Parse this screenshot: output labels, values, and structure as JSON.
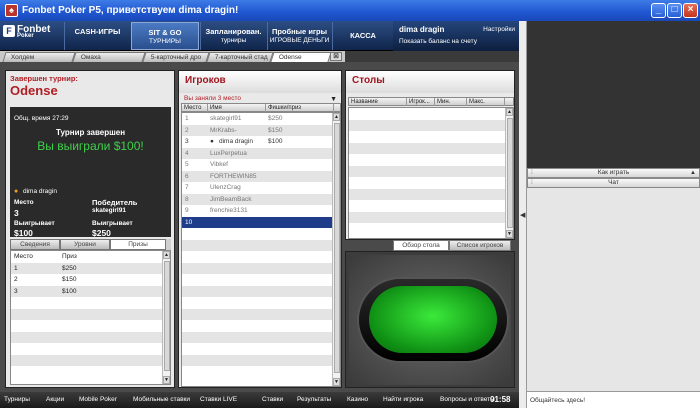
{
  "window": {
    "title": "Fonbet Poker P5, приветствуем dima dragin!",
    "icon": "fonbet-app-icon"
  },
  "logo": {
    "name": "Fonbet",
    "sub": "Poker",
    "mark": "F"
  },
  "nav": [
    {
      "l1": "CASH-ИГРЫ",
      "l2": ""
    },
    {
      "l1": "SIT & GO",
      "l2": "ТУРНИРЫ"
    },
    {
      "l1": "Запланирован.",
      "l2": "турниры"
    },
    {
      "l1": "Пробные игры",
      "l2": "ИГРОВЫЕ ДЕНЬГИ"
    },
    {
      "l1": "КАССА",
      "l2": ""
    }
  ],
  "user": {
    "name": "dima dragin",
    "settings": "Настройки",
    "balance": "Показать баланс на счету"
  },
  "game_tabs": [
    "Холдем",
    "Омаха",
    "5-карточный дро",
    "7-карточный стад",
    "Odense"
  ],
  "tournament": {
    "status": "Завершен турнир:",
    "name": "Odense",
    "time_label": "Общ. время",
    "time": "27:29",
    "done": "Турнир завершен",
    "won": "Вы выиграли $100!",
    "player": "dima dragin",
    "place_label": "Место",
    "place": "3",
    "wins_label": "Выигрывает",
    "wins": "$100",
    "winner_label": "Победитель",
    "winner": "skategirl91",
    "winner_wins_label": "Выигрывает",
    "winner_wins": "$250"
  },
  "info_tabs": [
    "Сведения",
    "Уровни",
    "Призы"
  ],
  "prizes": {
    "headers": [
      "Место",
      "Приз"
    ],
    "rows": [
      [
        "1",
        "$250"
      ],
      [
        "2",
        "$150"
      ],
      [
        "3",
        "$100"
      ]
    ]
  },
  "players_panel": {
    "title": "Игроков",
    "place_note": "Вы заняли  3 место",
    "headers": [
      "Место",
      "Имя",
      "Фишки/приз"
    ],
    "rows": [
      [
        "1",
        "skategirl91",
        "$250"
      ],
      [
        "2",
        "MrKrabs-",
        "$150"
      ],
      [
        "3",
        "dima dragin",
        "$100"
      ],
      [
        "4",
        "LuxPerpetua",
        ""
      ],
      [
        "5",
        "Vibkef",
        ""
      ],
      [
        "6",
        "FORTHEWIN85",
        ""
      ],
      [
        "7",
        "UlenzCrag",
        ""
      ],
      [
        "8",
        "JimBeamBack",
        ""
      ],
      [
        "9",
        "frenchie3131",
        ""
      ],
      [
        "10",
        "",
        ""
      ]
    ]
  },
  "tables_panel": {
    "title": "Столы",
    "headers": [
      "Название",
      "Игрок...",
      "Мин.",
      "Макс."
    ]
  },
  "view_tabs": [
    "Обзор стола",
    "Список игроков"
  ],
  "footer": {
    "items": [
      "Турниры",
      "Акции",
      "Mobile Poker",
      "Мобильные ставки",
      "Ставки LIVE",
      "Ставки",
      "Результаты",
      "Казино",
      "Найти игрока",
      "Вопросы и ответы"
    ],
    "clock": "01:58"
  },
  "sidebar": {
    "how_to_play": "Как играть",
    "chat": "Чат",
    "chat_placeholder": "Общайтесь здесь!"
  }
}
